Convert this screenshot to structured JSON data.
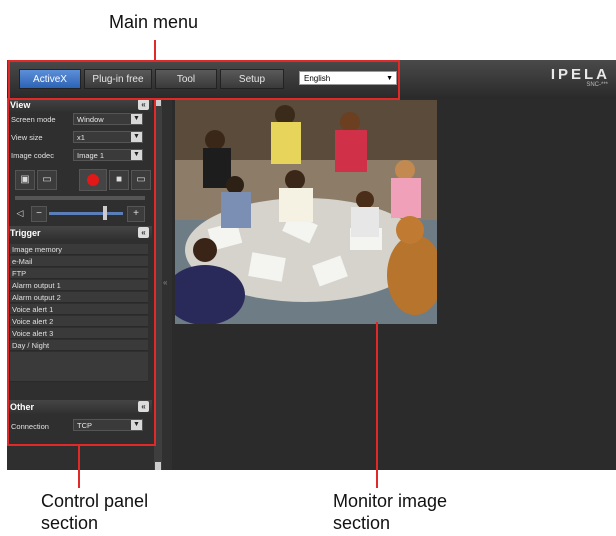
{
  "callouts": {
    "main_menu": "Main menu",
    "control_panel_line1": "Control panel",
    "control_panel_line2": "section",
    "monitor_line1": "Monitor image",
    "monitor_line2": "section"
  },
  "main_menu": {
    "tabs": [
      "ActiveX",
      "Plug-in free",
      "Tool",
      "Setup"
    ],
    "active_tab": "ActiveX",
    "language": "English"
  },
  "brand": {
    "logo": "IPELA",
    "model": "SNC-***"
  },
  "view": {
    "title": "View",
    "screen_mode_label": "Screen mode",
    "screen_mode_value": "Window",
    "view_size_label": "View size",
    "view_size_value": "x1",
    "image_codec_label": "Image codec",
    "image_codec_value": "Image 1",
    "minus": "−",
    "plus": "+"
  },
  "trigger": {
    "title": "Trigger",
    "items": [
      "Image memory",
      "e-Mail",
      "FTP",
      "Alarm output 1",
      "Alarm output 2",
      "Voice alert 1",
      "Voice alert 2",
      "Voice alert 3",
      "Day / Night"
    ]
  },
  "other": {
    "title": "Other",
    "connection_label": "Connection",
    "connection_value": "TCP"
  },
  "colors": {
    "accent_tab": "#2d63b5",
    "callout_red": "#e02a2a",
    "record": "#e01818"
  },
  "icons": [
    "capture-icon",
    "folder-icon",
    "record-icon",
    "stop-icon",
    "speaker-icon",
    "collapse-icon",
    "dropdown-icon"
  ]
}
